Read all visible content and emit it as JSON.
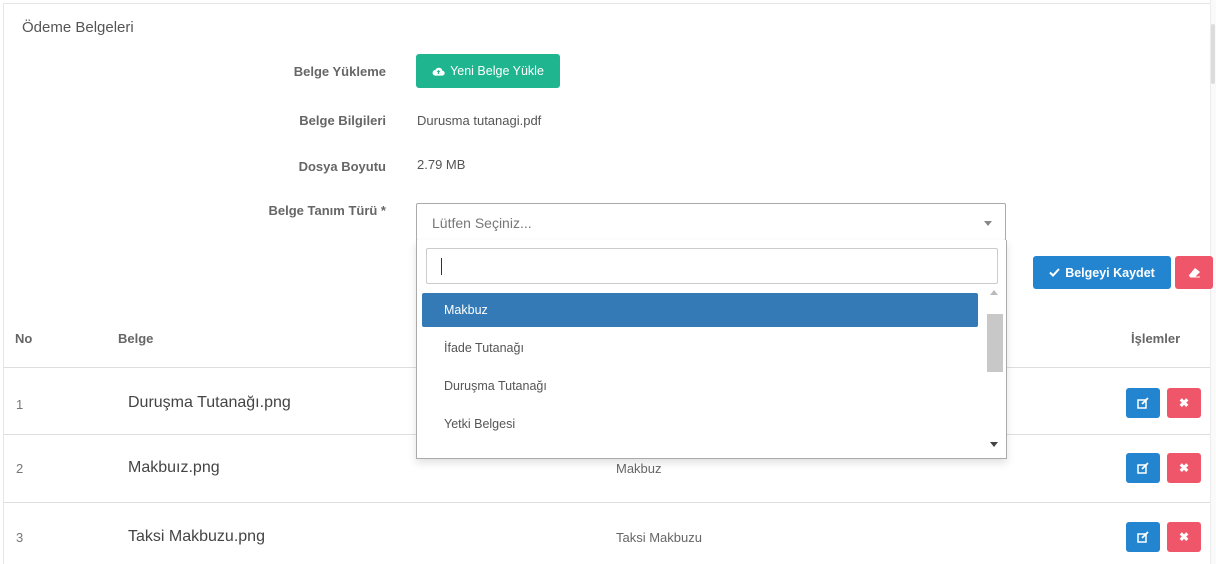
{
  "panel": {
    "title": "Ödeme Belgeleri"
  },
  "form": {
    "upload_label": "Belge Yükleme",
    "upload_button": "Yeni Belge Yükle",
    "info_label": "Belge Bilgileri",
    "info_value": "Durusma tutanagi.pdf",
    "size_label": "Dosya Boyutu",
    "size_value": "2.79 MB",
    "type_label": "Belge Tanım Türü *",
    "type_placeholder": "Lütfen Seçiniz..."
  },
  "dropdown": {
    "search_value": "",
    "options": [
      "Makbuz",
      "İfade Tutanağı",
      "Duruşma Tutanağı",
      "Yetki Belgesi"
    ],
    "selected_index": 0
  },
  "actions": {
    "save_label": "Belgeyi Kaydet"
  },
  "table": {
    "columns": {
      "no": "No",
      "file": "Belge",
      "actions": "İşlemler"
    },
    "rows": [
      {
        "no": "1",
        "file": "Duruşma Tutanağı.png",
        "type": ""
      },
      {
        "no": "2",
        "file": "Makbuız.png",
        "type": "Makbuz"
      },
      {
        "no": "3",
        "file": "Taksi Makbuzu.png",
        "type": "Taksi Makbuzu"
      }
    ]
  },
  "colors": {
    "upload_button": "#1fb68f",
    "primary": "#2385d0",
    "danger": "#f0566a",
    "selected_option": "#337ab7"
  },
  "icons": {
    "upload": "cloud-upload-icon",
    "save": "check-icon",
    "clear": "eraser-icon",
    "edit": "edit-icon",
    "delete": "times-icon"
  }
}
